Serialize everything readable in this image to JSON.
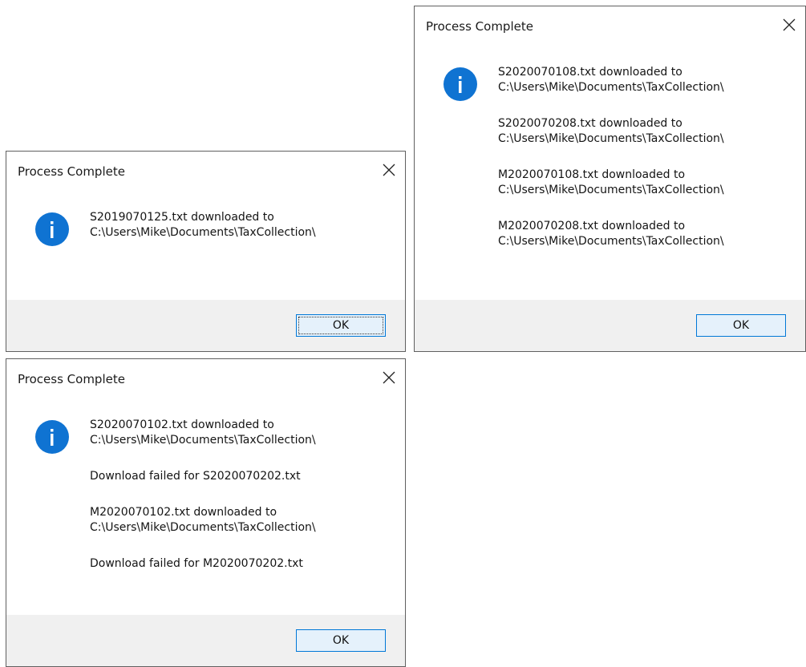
{
  "dialogs": [
    {
      "title": "Process Complete",
      "messages": [
        "S2019070125.txt downloaded to\nC:\\Users\\Mike\\Documents\\TaxCollection\\"
      ],
      "ok_label": "OK",
      "close_icon": "close-icon",
      "info_icon": "info-icon"
    },
    {
      "title": "Process Complete",
      "messages": [
        "S2020070108.txt downloaded to\nC:\\Users\\Mike\\Documents\\TaxCollection\\",
        "S2020070208.txt downloaded to\nC:\\Users\\Mike\\Documents\\TaxCollection\\",
        "M2020070108.txt downloaded to\nC:\\Users\\Mike\\Documents\\TaxCollection\\",
        "M2020070208.txt downloaded to\nC:\\Users\\Mike\\Documents\\TaxCollection\\"
      ],
      "ok_label": "OK",
      "close_icon": "close-icon",
      "info_icon": "info-icon"
    },
    {
      "title": "Process Complete",
      "messages": [
        "S2020070102.txt downloaded to\nC:\\Users\\Mike\\Documents\\TaxCollection\\",
        "Download failed for S2020070202.txt",
        "M2020070102.txt downloaded to\nC:\\Users\\Mike\\Documents\\TaxCollection\\",
        "Download failed for M2020070202.txt"
      ],
      "ok_label": "OK",
      "close_icon": "close-icon",
      "info_icon": "info-icon"
    }
  ],
  "colors": {
    "accent": "#0078d7",
    "info_icon_bg": "#0f73d2",
    "footer_bg": "#f0f0f0"
  }
}
